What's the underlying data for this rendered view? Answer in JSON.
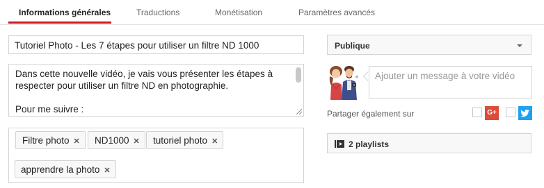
{
  "tabs": [
    {
      "label": "Informations générales",
      "active": true
    },
    {
      "label": "Traductions",
      "active": false
    },
    {
      "label": "Monétisation",
      "active": false
    },
    {
      "label": "Paramètres avancés",
      "active": false
    }
  ],
  "video": {
    "title": "Tutoriel Photo - Les 7 étapes pour utiliser un filtre ND 1000",
    "description_lines": [
      "Dans cette nouvelle vidéo, je vais vous présenter les étapes à",
      "respecter pour utiliser un filtre ND en photographie.",
      "",
      "Pour me suivre :",
      "--------------------------------"
    ],
    "tags": [
      "Filtre photo",
      "ND1000",
      "tutoriel photo",
      "apprendre la photo"
    ]
  },
  "privacy": {
    "selected": "Publique"
  },
  "message": {
    "placeholder": "Ajouter un message à votre vidéo"
  },
  "share": {
    "label": "Partager également sur",
    "gplus_label": "G+"
  },
  "playlists": {
    "label": "2 playlists"
  },
  "colors": {
    "accent": "#cc181e",
    "gplus": "#dd4b39",
    "twitter": "#1da1f2"
  }
}
